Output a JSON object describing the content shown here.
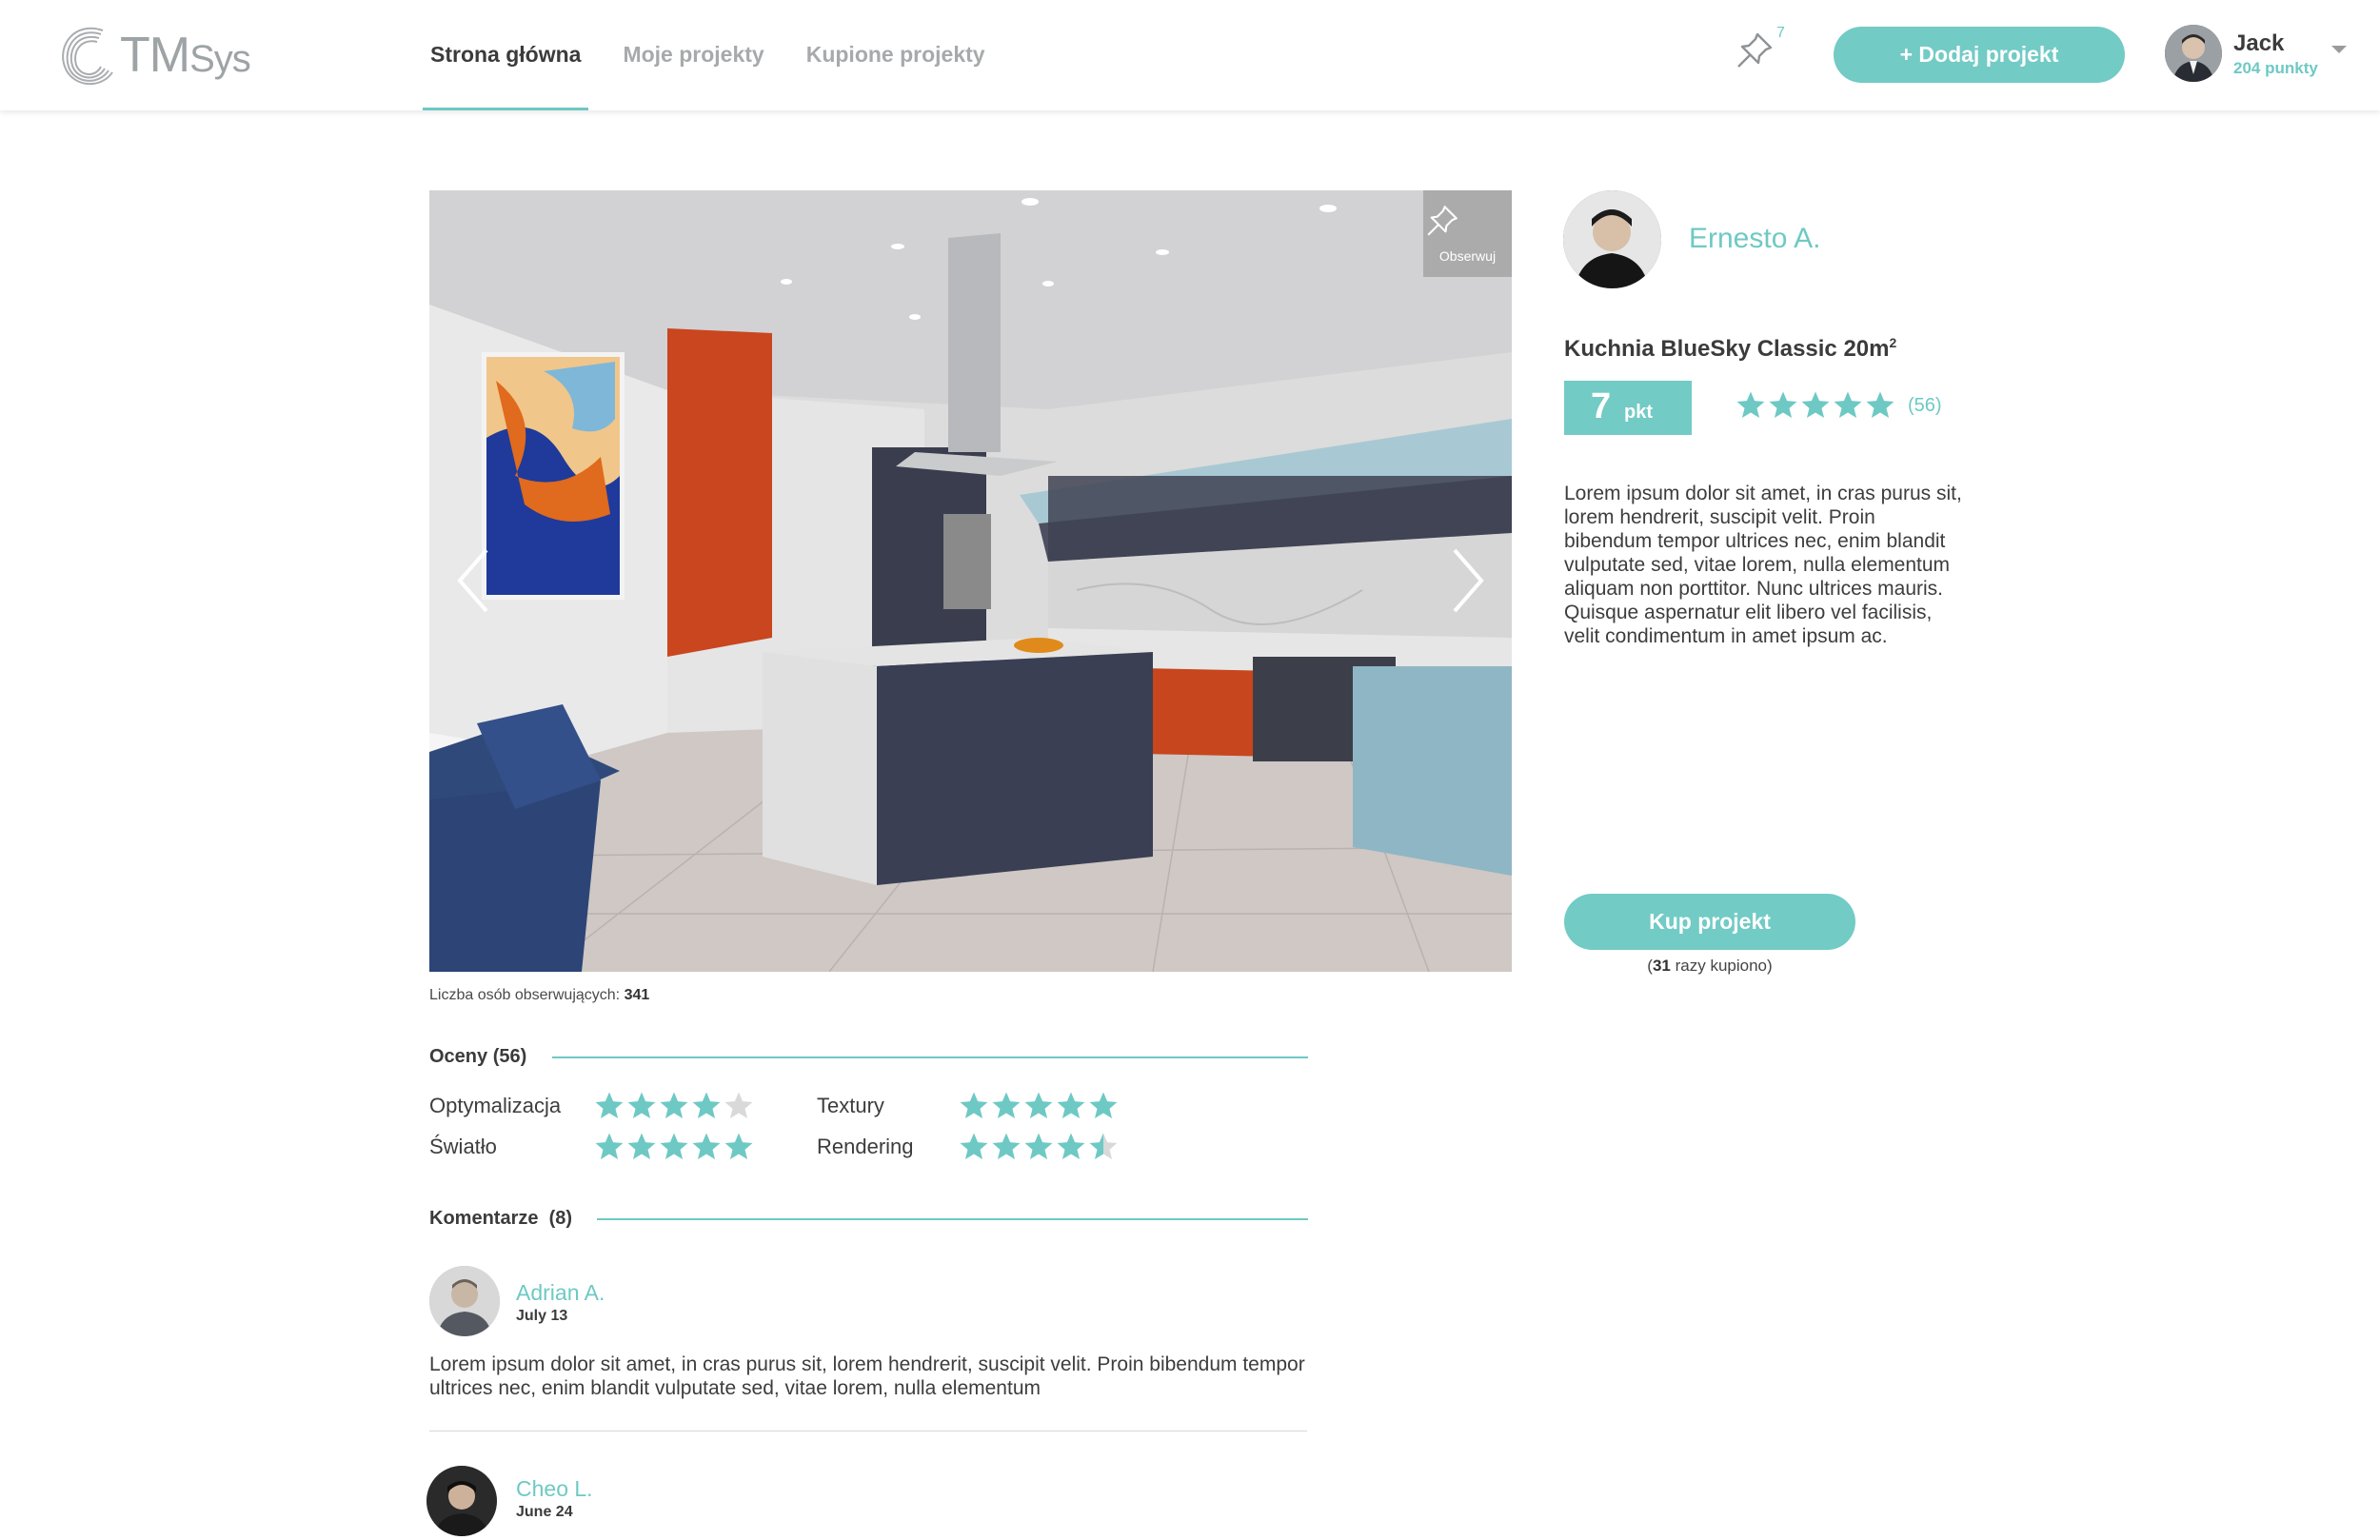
{
  "brand": {
    "logo_text_main": "TM",
    "logo_text_sub": "Sys",
    "accent_color": "#6ec9c4"
  },
  "nav": {
    "items": [
      {
        "label": "Strona główna",
        "active": true
      },
      {
        "label": "Moje projekty",
        "active": false
      },
      {
        "label": "Kupione projekty",
        "active": false
      }
    ]
  },
  "header": {
    "pin_icon": "pin-icon",
    "pin_count": "7",
    "add_button_label": "+  Dodaj projekt",
    "user_name": "Jack",
    "user_points": "204 punkty"
  },
  "gallery": {
    "follow_label": "Obserwuj",
    "followers_label": "Liczba osób obserwujących:",
    "followers_count": "341"
  },
  "author": {
    "name": "Ernesto A."
  },
  "project": {
    "title": "Kuchnia BlueSky Classic 20m",
    "title_sup": "2",
    "price": "7",
    "price_unit": "pkt",
    "rating": 5,
    "rating_count": "(56)",
    "description": "Lorem ipsum dolor sit amet, in cras purus sit, lorem hendrerit, suscipit velit. Proin bibendum tempor ultrices nec, enim blandit vulputate sed, vitae lorem, nulla elementum aliquam non porttitor. Nunc ultrices mauris. Quisque aspernatur elit libero vel facilisis, velit condimentum in amet ipsum ac.",
    "buy_label": "Kup projekt",
    "bought_count": "31",
    "bought_text": "razy kupiono)",
    "bought_prefix": "("
  },
  "ratings": {
    "heading": "Oceny (56)",
    "criteria": [
      {
        "label": "Optymalizacja",
        "value": 4
      },
      {
        "label": "Textury",
        "value": 5
      },
      {
        "label": "Światło",
        "value": 5
      },
      {
        "label": "Rendering",
        "value": 4.5
      }
    ]
  },
  "comments": {
    "heading": "Komentarze",
    "count": "(8)",
    "items": [
      {
        "author": "Adrian A.",
        "date": "July 13",
        "text": "Lorem ipsum dolor sit amet, in cras purus sit, lorem hendrerit, suscipit velit. Proin bibendum tempor ultrices nec, enim blandit vulputate sed, vitae lorem, nulla elementum"
      },
      {
        "author": "Cheo L.",
        "date": "June 24",
        "text": ""
      }
    ]
  }
}
